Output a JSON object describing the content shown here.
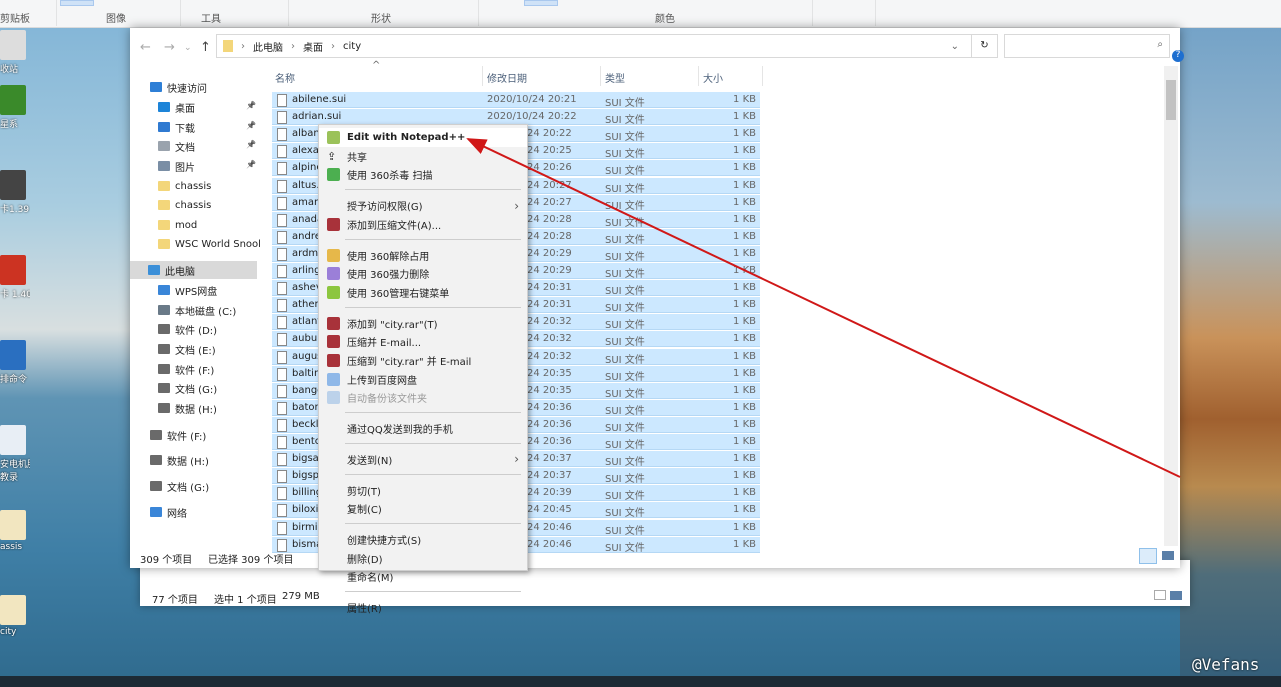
{
  "ribbon": {
    "groups": [
      "剪贴板",
      "图像",
      "工具",
      "形状",
      "颜色"
    ]
  },
  "desktop_icons": [
    "收站",
    "星系",
    "卡1.39",
    "卡 1.40",
    "排命令",
    "安电机服\n教录",
    "assis",
    "city"
  ],
  "explorer": {
    "breadcrumb": [
      "此电脑",
      "桌面",
      "city"
    ],
    "search_placeholder": "",
    "columns": {
      "name": "名称",
      "date": "修改日期",
      "type": "类型",
      "size": "大小"
    },
    "nav": [
      {
        "label": "快速访问",
        "icon": "star-icon",
        "color": "#2e7fd6"
      },
      {
        "label": "桌面",
        "icon": "desktop-icon",
        "color": "#1d84d8",
        "pinned": true
      },
      {
        "label": "下载",
        "icon": "download-icon",
        "color": "#2f7ad1",
        "pinned": true
      },
      {
        "label": "文档",
        "icon": "document-icon",
        "color": "#9aa3ad",
        "pinned": true
      },
      {
        "label": "图片",
        "icon": "pictures-icon",
        "color": "#7a8ea5",
        "pinned": true
      },
      {
        "label": "chassis",
        "icon": "folder-icon",
        "color": "#f3d67a"
      },
      {
        "label": "chassis",
        "icon": "folder-icon",
        "color": "#f3d67a"
      },
      {
        "label": "mod",
        "icon": "folder-icon",
        "color": "#f3d67a"
      },
      {
        "label": "WSC World Snool",
        "icon": "folder-icon",
        "color": "#f3d67a"
      },
      {
        "label": "此电脑",
        "icon": "computer-icon",
        "color": "#3b8fd8",
        "selected": true
      },
      {
        "label": "WPS网盘",
        "icon": "cloud-icon",
        "color": "#3a86d8"
      },
      {
        "label": "本地磁盘 (C:)",
        "icon": "drive-icon",
        "color": "#6a7a88"
      },
      {
        "label": "软件 (D:)",
        "icon": "drive-icon",
        "color": "#6a6a6a"
      },
      {
        "label": "文档 (E:)",
        "icon": "drive-icon",
        "color": "#6a6a6a"
      },
      {
        "label": "软件 (F:)",
        "icon": "drive-icon",
        "color": "#6a6a6a"
      },
      {
        "label": "文档 (G:)",
        "icon": "drive-icon",
        "color": "#6a6a6a"
      },
      {
        "label": "数据 (H:)",
        "icon": "drive-icon",
        "color": "#6a6a6a"
      },
      {
        "label": "软件 (F:)",
        "icon": "drive-icon",
        "color": "#6a6a6a"
      },
      {
        "label": "数据 (H:)",
        "icon": "drive-icon",
        "color": "#6a6a6a"
      },
      {
        "label": "文档 (G:)",
        "icon": "drive-icon",
        "color": "#6a6a6a"
      },
      {
        "label": "网络",
        "icon": "network-icon",
        "color": "#3a86d8"
      }
    ],
    "files": [
      {
        "name": "abilene.sui",
        "date": "2020/10/24 20:21"
      },
      {
        "name": "adrian.sui",
        "date": "2020/10/24 20:22"
      },
      {
        "name": "alban",
        "date": "24 20:22"
      },
      {
        "name": "alexan",
        "date": "24 20:25"
      },
      {
        "name": "alpine",
        "date": "24 20:26"
      },
      {
        "name": "altus.s",
        "date": "24 20:27"
      },
      {
        "name": "amari",
        "date": "24 20:27"
      },
      {
        "name": "anada",
        "date": "24 20:28"
      },
      {
        "name": "andre",
        "date": "24 20:28"
      },
      {
        "name": "ardm",
        "date": "24 20:29"
      },
      {
        "name": "arling",
        "date": "24 20:29"
      },
      {
        "name": "ashev",
        "date": "24 20:31"
      },
      {
        "name": "athen",
        "date": "24 20:31"
      },
      {
        "name": "atlant",
        "date": "24 20:32"
      },
      {
        "name": "aubur",
        "date": "24 20:32"
      },
      {
        "name": "augus",
        "date": "24 20:32"
      },
      {
        "name": "baltim",
        "date": "24 20:35"
      },
      {
        "name": "bango",
        "date": "24 20:35"
      },
      {
        "name": "baton",
        "date": "24 20:36"
      },
      {
        "name": "beckl",
        "date": "24 20:36"
      },
      {
        "name": "bentc",
        "date": "24 20:36"
      },
      {
        "name": "bigsa",
        "date": "24 20:37"
      },
      {
        "name": "bigsp",
        "date": "24 20:37"
      },
      {
        "name": "billing",
        "date": "24 20:39"
      },
      {
        "name": "biloxi",
        "date": "24 20:45"
      },
      {
        "name": "birmi",
        "date": "24 20:46"
      },
      {
        "name": "bisma",
        "date": "24 20:46"
      }
    ],
    "file_type": "SUI 文件",
    "file_size": "1 KB",
    "status": {
      "count": "309 个项目",
      "selected": "已选择 309 个项目"
    }
  },
  "back_window": {
    "status": {
      "count": "77 个项目",
      "selected": "选中 1 个项目",
      "size": "279 MB"
    }
  },
  "context_menu": [
    {
      "label": "Edit with Notepad++",
      "icon": "notepadpp-icon",
      "color": "#9bc25a",
      "bold": true,
      "highlight": true
    },
    {
      "label": "共享",
      "icon": "share-icon",
      "color": ""
    },
    {
      "label": "使用 360杀毒 扫描",
      "icon": "shield-360-icon",
      "color": "#4caf50"
    },
    {
      "sep": true
    },
    {
      "label": "授予访问权限(G)",
      "submenu": true
    },
    {
      "label": "添加到压缩文件(A)...",
      "icon": "winrar-icon",
      "color": "#a8323a"
    },
    {
      "sep": true
    },
    {
      "label": "使用 360解除占用",
      "icon": "unlock-360-icon",
      "color": "#e6b84a"
    },
    {
      "label": "使用 360强力删除",
      "icon": "delete-360-icon",
      "color": "#9b7fd8"
    },
    {
      "label": "使用 360管理右键菜单",
      "icon": "menu-360-icon",
      "color": "#8cc63f"
    },
    {
      "sep": true
    },
    {
      "label": "添加到 \"city.rar\"(T)",
      "icon": "winrar-icon",
      "color": "#a8323a"
    },
    {
      "label": "压缩并 E-mail...",
      "icon": "winrar-icon",
      "color": "#a8323a"
    },
    {
      "label": "压缩到 \"city.rar\" 并 E-mail",
      "icon": "winrar-icon",
      "color": "#a8323a"
    },
    {
      "label": "上传到百度网盘",
      "icon": "baidu-icon",
      "color": "#8fb8e8"
    },
    {
      "label": "自动备份该文件夹",
      "icon": "baidu-icon",
      "color": "#bcd2ea",
      "disabled": true
    },
    {
      "sep": true
    },
    {
      "label": "通过QQ发送到我的手机"
    },
    {
      "sep": true
    },
    {
      "label": "发送到(N)",
      "submenu": true
    },
    {
      "sep": true
    },
    {
      "label": "剪切(T)"
    },
    {
      "label": "复制(C)"
    },
    {
      "sep": true
    },
    {
      "label": "创建快捷方式(S)"
    },
    {
      "label": "删除(D)"
    },
    {
      "label": "重命名(M)"
    },
    {
      "sep": true
    },
    {
      "label": "属性(R)"
    }
  ],
  "annotation": {
    "arrow_color": "#d01818"
  },
  "watermark": "@Vefans"
}
